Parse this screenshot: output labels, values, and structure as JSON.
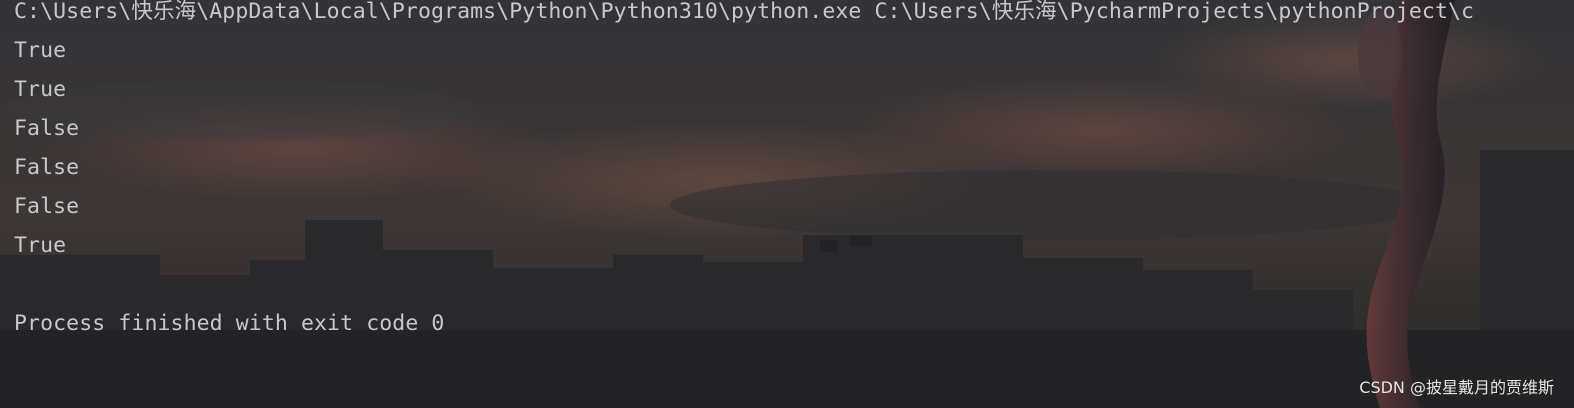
{
  "console": {
    "command_line": "C:\\Users\\快乐海\\AppData\\Local\\Programs\\Python\\Python310\\python.exe C:\\Users\\快乐海\\PycharmProjects\\pythonProject\\c",
    "output_lines": [
      "True",
      "True",
      "False",
      "False",
      "False",
      "True"
    ],
    "exit_message": "Process finished with exit code 0"
  },
  "watermark": {
    "text": "CSDN @披星戴月的贾维斯"
  },
  "colors": {
    "text": "#c8c8cc",
    "background": "#2b2b2d",
    "sky_glow": "#6b4a44"
  }
}
